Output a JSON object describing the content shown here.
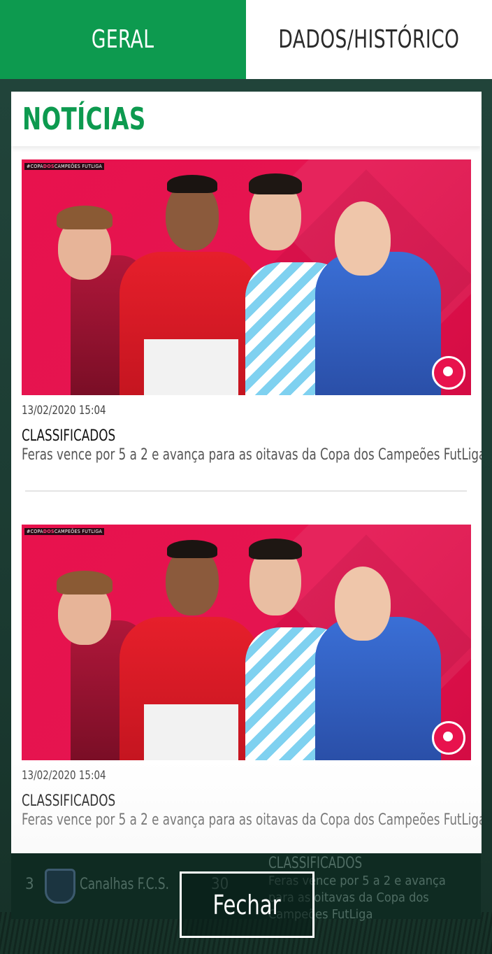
{
  "tabs": [
    {
      "label": "GERAL",
      "active": true
    },
    {
      "label": "DADOS/HISTÓRICO",
      "active": false
    }
  ],
  "modal": {
    "title": "NOTÍCIAS",
    "news": [
      {
        "date": "13/02/2020 15:04",
        "category": "CLASSIFICADOS",
        "headline": "Feras vence por 5 a 2 e avança para as oitavas da Copa dos Campeões FutLiga",
        "image_tag_prefix": "#COPA",
        "image_tag_mid": "DOS",
        "image_tag_rest": "CAMPEÕES FUTLIGA"
      },
      {
        "date": "13/02/2020 15:04",
        "category": "CLASSIFICADOS",
        "headline": "Feras vence por 5 a 2 e avança para as oitavas da Copa dos Campeões FutLiga",
        "image_tag_prefix": "#COPA",
        "image_tag_mid": "DOS",
        "image_tag_rest": "CAMPEÕES FUTLIGA"
      }
    ]
  },
  "background_row": {
    "rank": "3",
    "team": "Canalhas F.C.S.",
    "points": "30",
    "news_category": "CLASSIFICADOS",
    "news_text": "Feras vence por 5 a 2 e avança para as oitavas da Copa dos Campeões FutLiga"
  },
  "close_button": {
    "label": "Fechar"
  },
  "colors": {
    "brand_green": "#0d9a4f",
    "image_pink": "#e8124d",
    "background_dark": "#1e3a30"
  }
}
